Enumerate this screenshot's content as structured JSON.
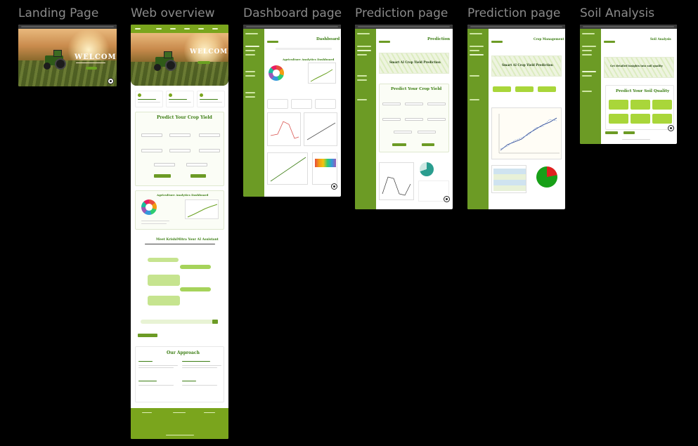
{
  "frames": [
    {
      "id": "landing",
      "title": "Landing Page"
    },
    {
      "id": "web-overview",
      "title": "Web overview"
    },
    {
      "id": "dashboard",
      "title": "Dashboard page"
    },
    {
      "id": "prediction-1",
      "title": "Prediction page"
    },
    {
      "id": "prediction-2",
      "title": "Prediction page"
    },
    {
      "id": "soil",
      "title": "Soil Analysis"
    }
  ],
  "hero": {
    "welcome": "WELCOME"
  },
  "overview": {
    "predict_heading": "Predict Your Crop Yield",
    "dashboard_heading": "Agriculture Analytics Dashboard",
    "assistant_heading": "Meet KrishiMitra Your AI Assistant",
    "approach_heading": "Our Approach"
  },
  "dashboard": {
    "page_title": "Dashboard",
    "heading": "Agriculture Analytics Dashboard"
  },
  "prediction": {
    "page_title": "Prediction",
    "hex_title": "Smart AI Crop Yield Prediction",
    "form_heading": "Predict Your Crop Yield"
  },
  "crop": {
    "page_title": "Crop Management",
    "hex_title": "Smart AI Crop Yield Prediction"
  },
  "soil": {
    "page_title": "Soil Analysis",
    "hex_title": "Get detailed insights into soil quality",
    "form_heading": "Predict Your Soil Quality"
  },
  "colors": {
    "primary_green": "#7aa51d",
    "heading_green": "#3b7d12",
    "light_green": "#a9d63a",
    "background": "#000000"
  }
}
